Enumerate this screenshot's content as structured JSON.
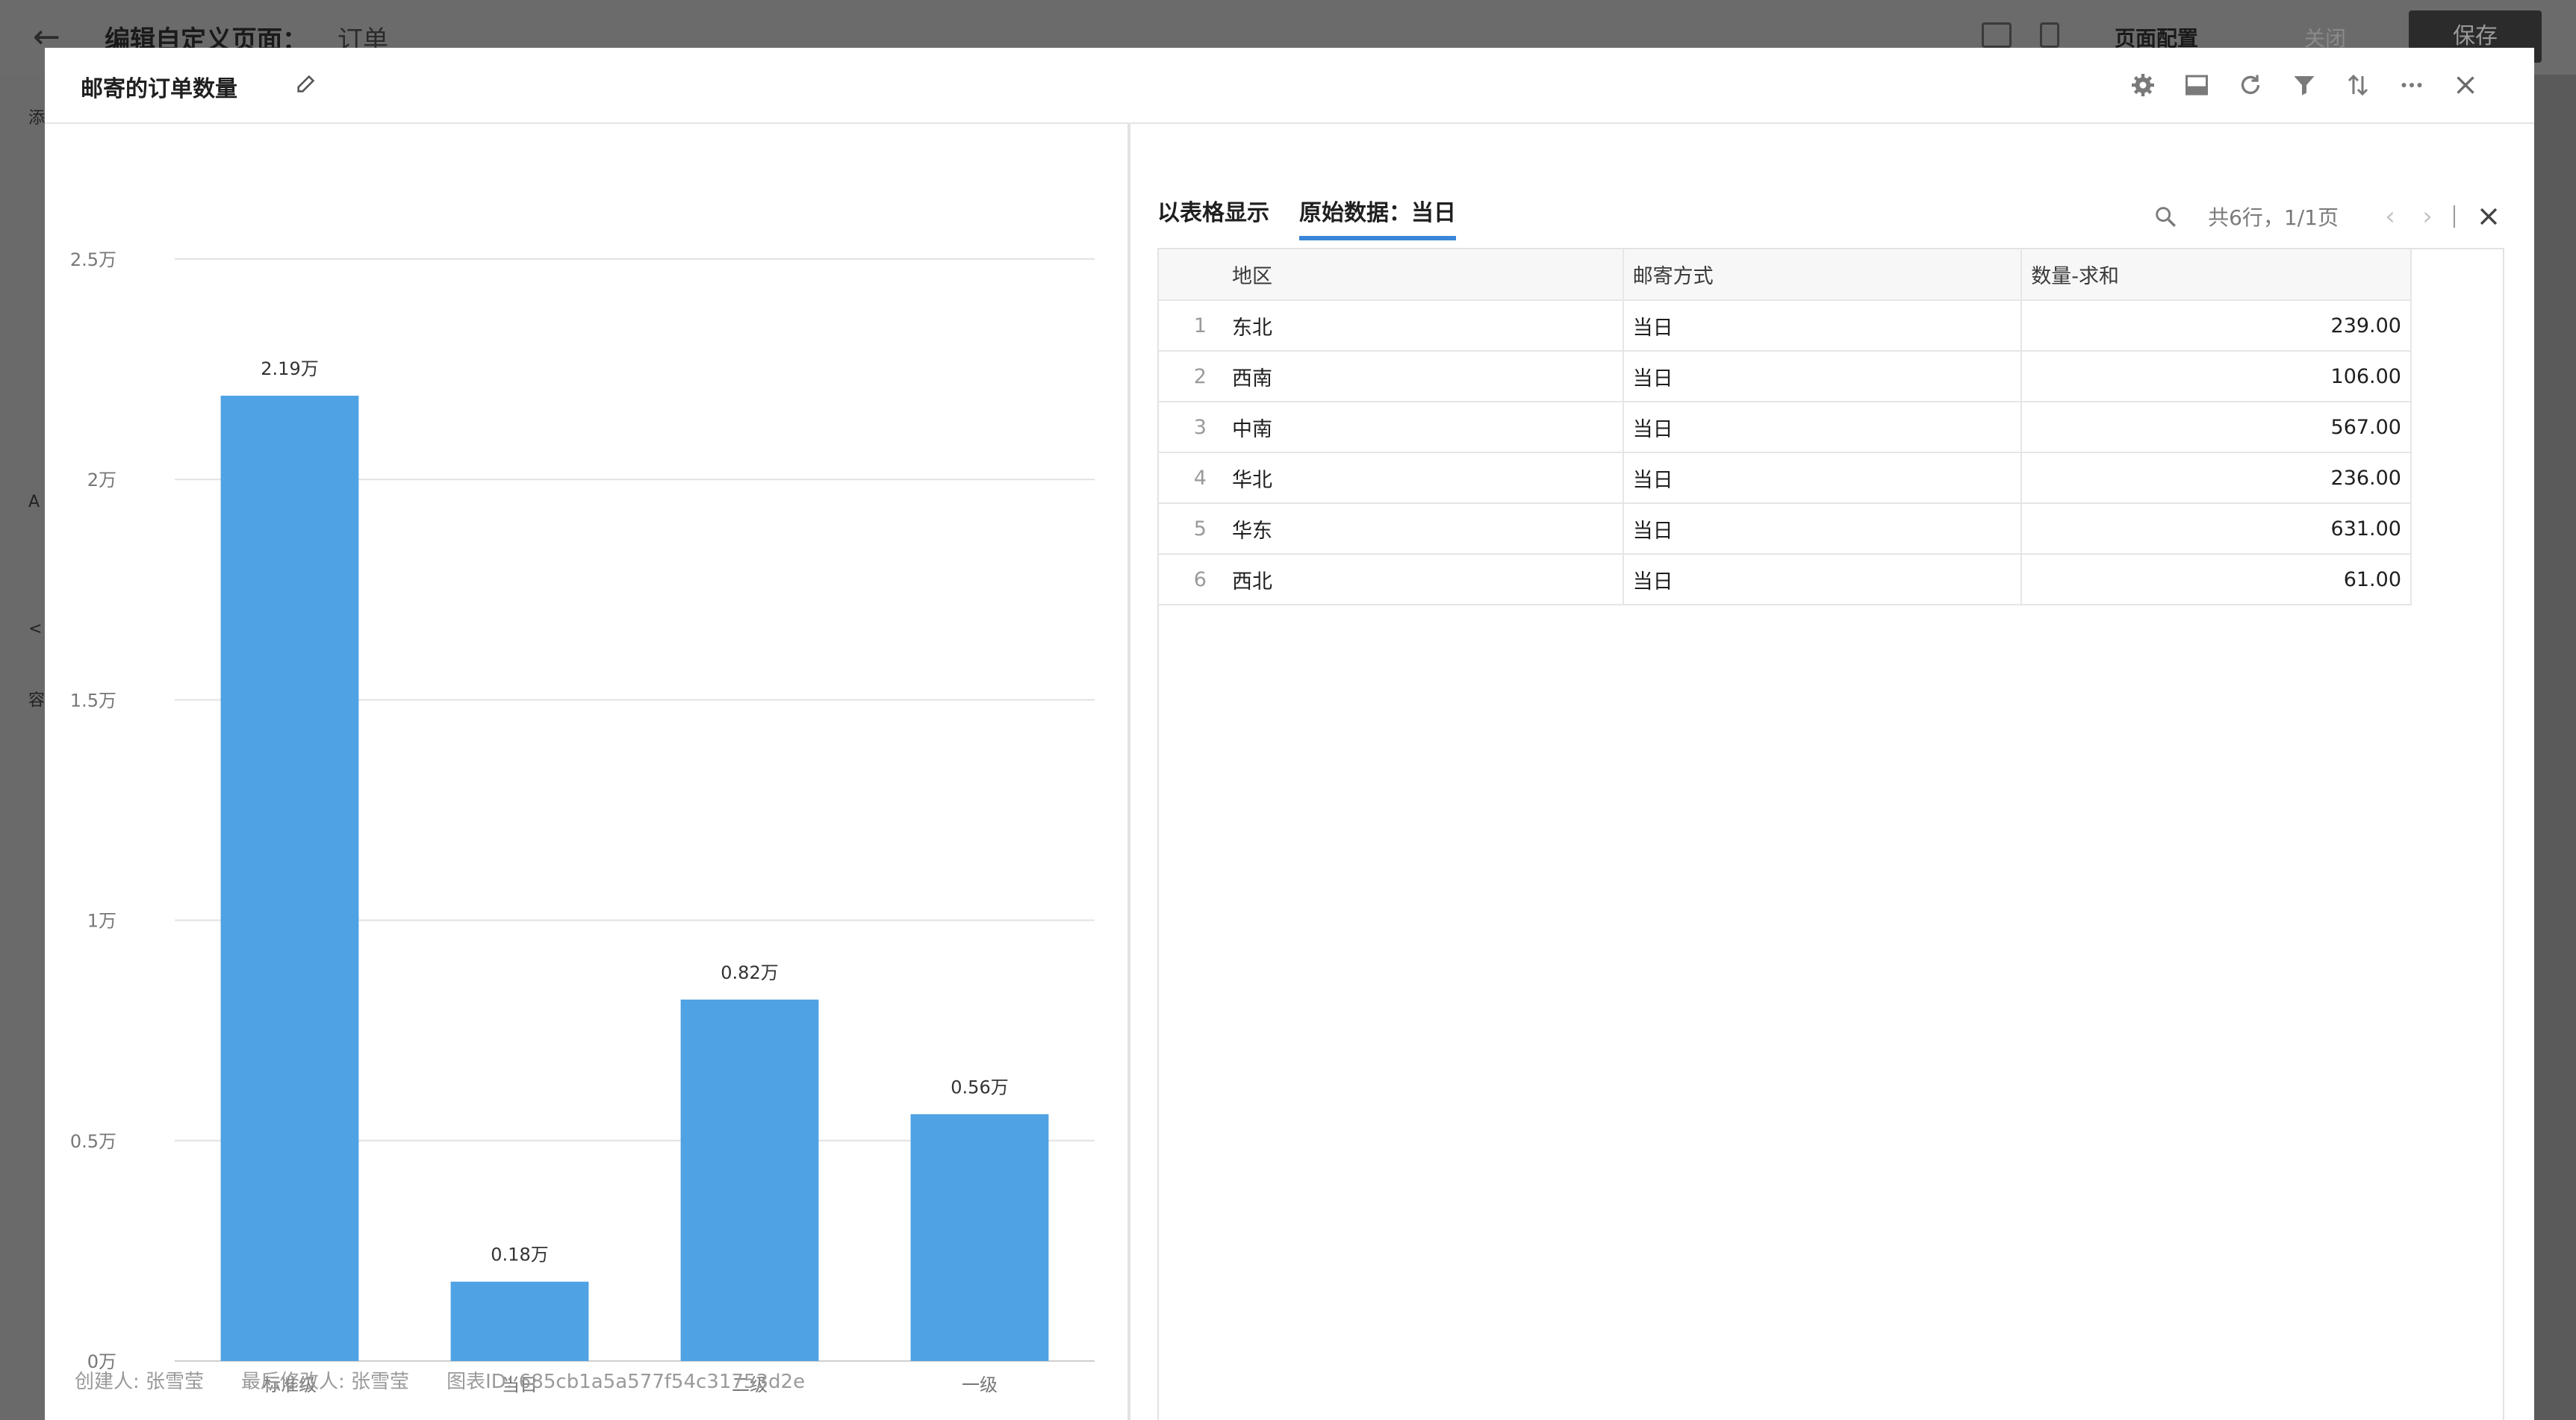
{
  "background": {
    "title": "编辑自定义页面：",
    "subtitle": "订单",
    "page_config": "页面配置",
    "close": "关闭",
    "save": "保存",
    "left_labels": [
      "添",
      "A",
      "<",
      "容"
    ]
  },
  "modal": {
    "title": "邮寄的订单数量",
    "tools": [
      "settings-icon",
      "screen-icon",
      "refresh-icon",
      "filter-icon",
      "sort-icon",
      "more-icon",
      "close-icon"
    ]
  },
  "chart_data": {
    "type": "bar",
    "categories": [
      "标准级",
      "当日",
      "二级",
      "一级"
    ],
    "values": [
      2.19,
      0.18,
      0.82,
      0.56
    ],
    "value_labels": [
      "2.19万",
      "0.18万",
      "0.82万",
      "0.56万"
    ],
    "yticks": [
      0,
      0.5,
      1,
      1.5,
      2,
      2.5
    ],
    "ytick_labels": [
      "0万",
      "0.5万",
      "1万",
      "1.5万",
      "2万",
      "2.5万"
    ],
    "ylim": [
      0,
      2.5
    ],
    "unit": "万",
    "grid": true,
    "color": "#4fa2e3"
  },
  "footer": {
    "creator": "创建人: 张雪莹",
    "modifier": "最后修改人: 张雪莹",
    "chart_id": "图表ID: 685cb1a5a577f54c31753d2e"
  },
  "panel": {
    "tab_table": "以表格显示",
    "tab_raw": "原始数据：当日",
    "count": "共6行，1/1页",
    "columns": [
      "地区",
      "邮寄方式",
      "数量-求和"
    ],
    "rows": [
      {
        "idx": "1",
        "region": "东北",
        "method": "当日",
        "sum": "239.00"
      },
      {
        "idx": "2",
        "region": "西南",
        "method": "当日",
        "sum": "106.00"
      },
      {
        "idx": "3",
        "region": "中南",
        "method": "当日",
        "sum": "567.00"
      },
      {
        "idx": "4",
        "region": "华北",
        "method": "当日",
        "sum": "236.00"
      },
      {
        "idx": "5",
        "region": "华东",
        "method": "当日",
        "sum": "631.00"
      },
      {
        "idx": "6",
        "region": "西北",
        "method": "当日",
        "sum": "61.00"
      }
    ]
  }
}
